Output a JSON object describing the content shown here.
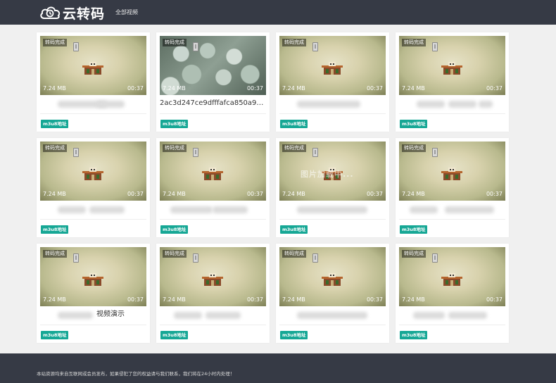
{
  "header": {
    "logo_text": "云转码",
    "nav_label": "全部视频"
  },
  "cards": [
    {
      "status": "转码完成",
      "size": "7.24 MB",
      "duration": "00:37",
      "title": "",
      "button": "m3u8地址",
      "thumb": "default"
    },
    {
      "status": "转码完成",
      "size": "7.24 MB",
      "duration": "00:37",
      "title": "2ac3d247ce9dfffafca850a9aa...",
      "button": "m3u8地址",
      "thumb": "photo"
    },
    {
      "status": "转码完成",
      "size": "7.24 MB",
      "duration": "00:37",
      "title": "",
      "button": "m3u8地址",
      "thumb": "default"
    },
    {
      "status": "转码完成",
      "size": "7.24 MB",
      "duration": "00:37",
      "title": "",
      "button": "m3u8地址",
      "thumb": "default"
    },
    {
      "status": "转码完成",
      "size": "7.24 MB",
      "duration": "00:37",
      "title": "",
      "button": "m3u8地址",
      "thumb": "default"
    },
    {
      "status": "转码完成",
      "size": "7.24 MB",
      "duration": "00:37",
      "title": "",
      "button": "m3u8地址",
      "thumb": "default"
    },
    {
      "status": "转码完成",
      "size": "7.24 MB",
      "duration": "00:37",
      "title": "",
      "button": "m3u8地址",
      "thumb": "default",
      "overlay": "图片加载中..."
    },
    {
      "status": "转码完成",
      "size": "7.24 MB",
      "duration": "00:37",
      "title": "",
      "button": "m3u8地址",
      "thumb": "default"
    },
    {
      "status": "转码完成",
      "size": "7.24 MB",
      "duration": "00:37",
      "title": "视频演示",
      "button": "m3u8地址",
      "thumb": "default"
    },
    {
      "status": "转码完成",
      "size": "7.24 MB",
      "duration": "00:37",
      "title": "",
      "button": "m3u8地址",
      "thumb": "default"
    },
    {
      "status": "转码完成",
      "size": "7.24 MB",
      "duration": "00:37",
      "title": "",
      "button": "m3u8地址",
      "thumb": "default"
    },
    {
      "status": "转码完成",
      "size": "7.24 MB",
      "duration": "00:37",
      "title": "",
      "button": "m3u8地址",
      "thumb": "default"
    }
  ],
  "footer": {
    "notice": "本站资源均来自互联网或会员发布，如果侵犯了您的权益请与我们联系，我们将在24小时内处理！"
  },
  "colors": {
    "header_bg": "#363a45",
    "accent": "#16a795",
    "page_bg": "#f0f0f0"
  }
}
